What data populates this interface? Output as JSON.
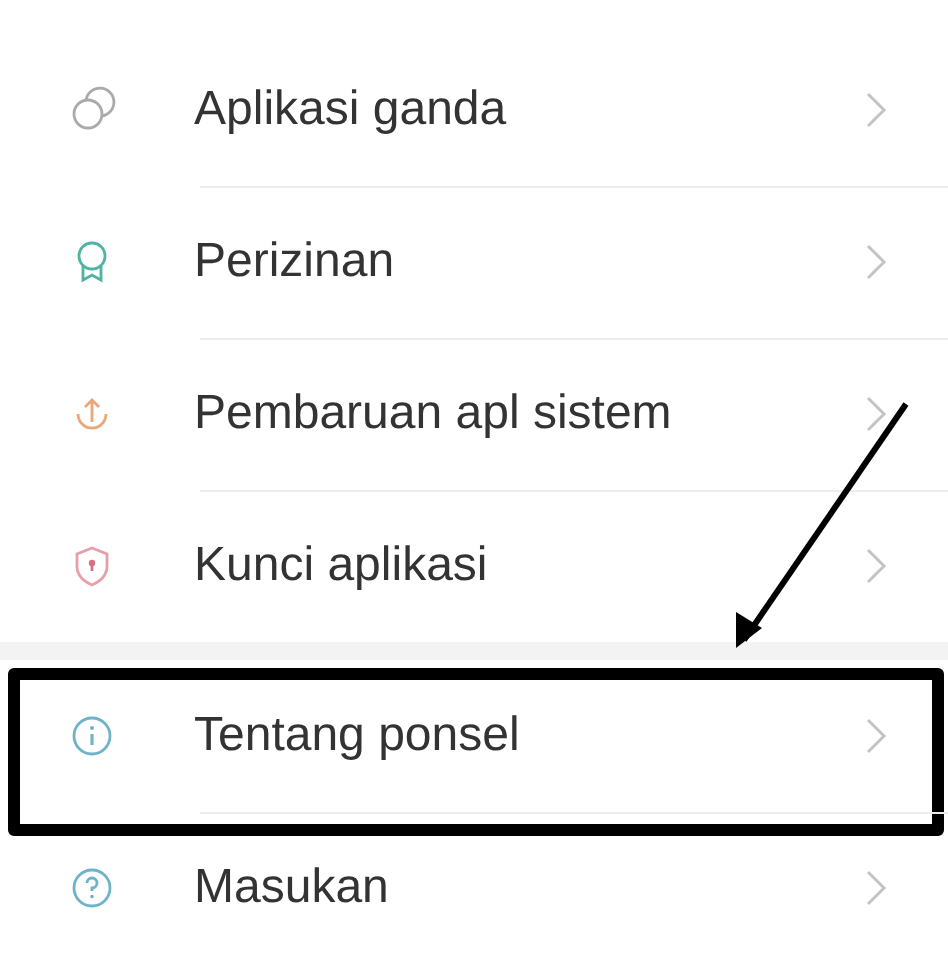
{
  "groups": [
    {
      "items": [
        {
          "label": "Aplikasi ganda",
          "highlighted": false
        },
        {
          "label": "Perizinan",
          "highlighted": false
        },
        {
          "label": "Pembaruan apl sistem",
          "highlighted": false
        },
        {
          "label": "Kunci aplikasi",
          "highlighted": false
        }
      ]
    },
    {
      "items": [
        {
          "label": "Tentang ponsel",
          "highlighted": true
        },
        {
          "label": "Masukan",
          "highlighted": false
        }
      ]
    }
  ]
}
